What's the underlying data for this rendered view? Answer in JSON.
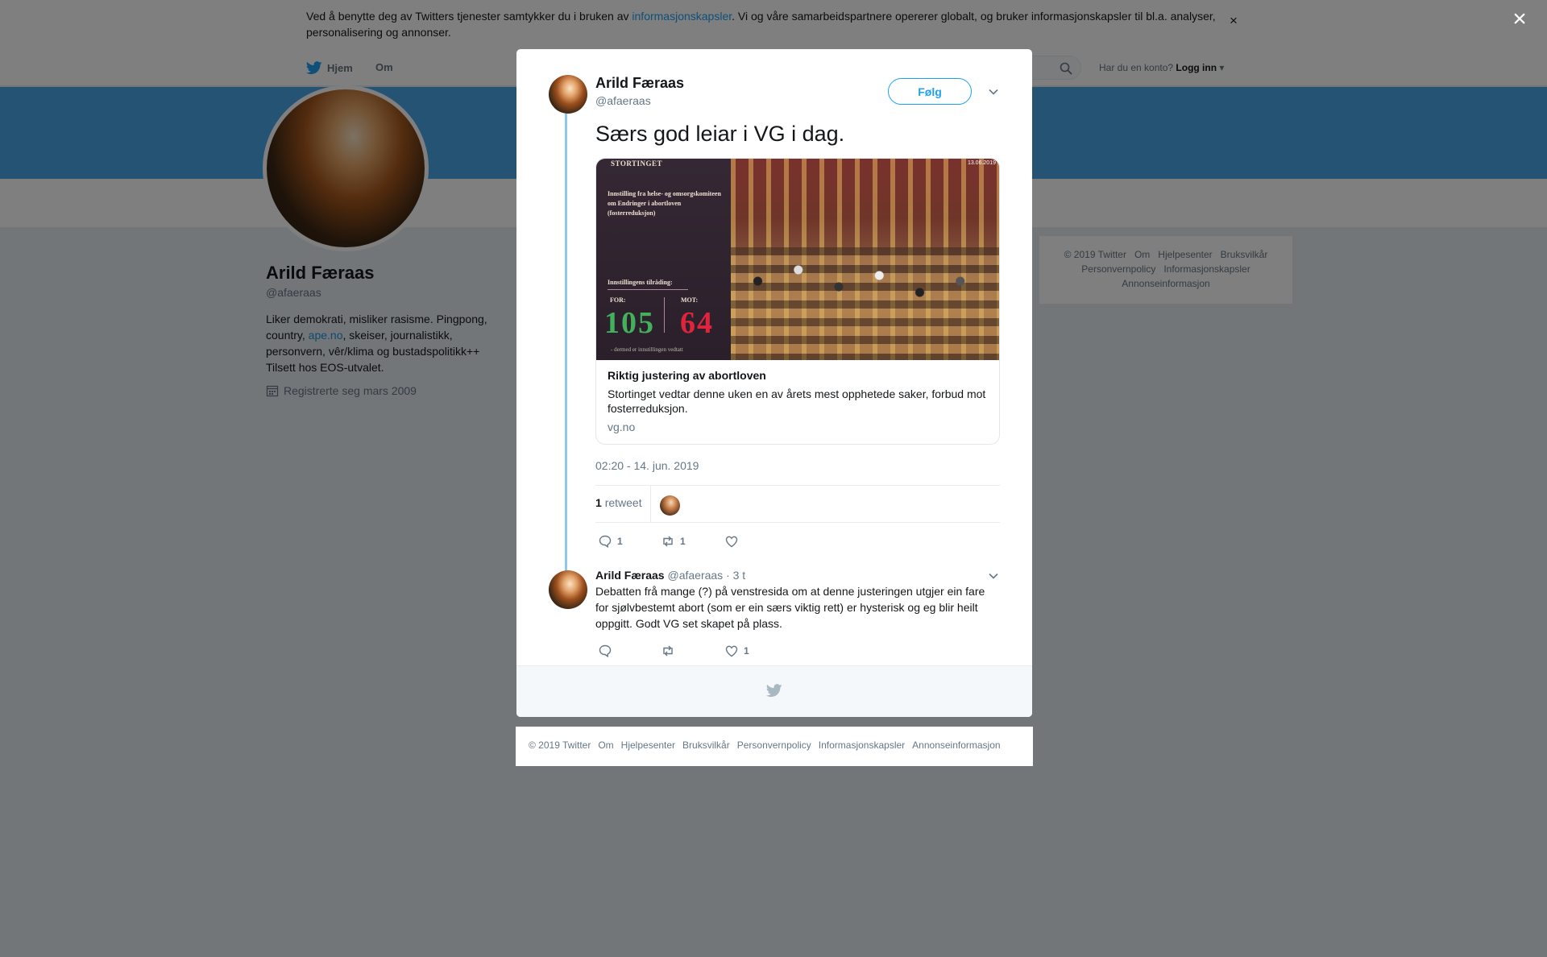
{
  "cookie_banner": {
    "text_before": "Ved å benytte deg av Twitters tjenester samtykker du i bruken av ",
    "link": "informasjonskapsler",
    "text_after": ". Vi og våre samarbeidspartnere opererer globalt, og bruker informasjonskapsler til bl.a. analyser, personalisering og annonser.",
    "close": "×"
  },
  "nav": {
    "home": "Hjem",
    "about": "Om",
    "login_prompt": "Har du en konto?",
    "login": "Logg inn"
  },
  "profile": {
    "name": "Arild Færaas",
    "handle": "@afaeraas",
    "bio_before": "Liker demokrati, misliker rasisme. Pingpong, country, ",
    "bio_link": "ape.no",
    "bio_after": ", skeiser, journalistikk, personvern, vêr/klima og bustadspolitikk++ Tilsett hos EOS-utvalet.",
    "joined": "Registrerte seg mars 2009"
  },
  "side_footer": [
    "© 2019 Twitter",
    "Om",
    "Hjelpesenter",
    "Bruksvilkår",
    "Personvernpolicy",
    "Informasjonskapsler",
    "Annonseinformasjon"
  ],
  "overlay_close": "×",
  "tweet": {
    "name": "Arild Færaas",
    "handle": "@afaeraas",
    "follow": "Følg",
    "text": "Særs god leiar i VG i dag.",
    "card": {
      "image": {
        "brand": "STORTINGET",
        "date": "13.06.2019",
        "heading": "Innstilling fra helse- og omsorgskomiteen om Endringer i abortloven (fosterreduksjon)",
        "recommendation": "Innstillingens tilråding:",
        "for_label": "FOR:",
        "for_value": "105",
        "against_label": "MOT:",
        "against_value": "64",
        "footnote": "- dermed er innstillingen vedtatt"
      },
      "title": "Riktig justering av abortloven",
      "description": "Stortinget vedtar denne uken en av årets mest opphetede saker, forbud mot fosterreduksjon.",
      "domain": "vg.no"
    },
    "timestamp": "02:20 - 14. jun. 2019",
    "retweet_count": "1",
    "retweet_label": "retweet",
    "actions": {
      "replies": "1",
      "retweets": "1",
      "likes": ""
    }
  },
  "reply": {
    "name": "Arild Færaas",
    "handle": "@afaeraas",
    "time": "· 3 t",
    "text": "Debatten frå mange (?) på venstresida om at denne justeringen utgjer ein fare for sjølvbestemt abort (som er ein særs viktig rett) er hysterisk og eg blir heilt oppgitt. Godt VG set skapet på plass.",
    "actions": {
      "replies": "",
      "retweets": "",
      "likes": "1"
    }
  },
  "footer": [
    "© 2019 Twitter",
    "Om",
    "Hjelpesenter",
    "Bruksvilkår",
    "Personvernpolicy",
    "Informasjonskapsler",
    "Annonseinformasjon"
  ],
  "colors": {
    "twitter_blue": "#1da1f2",
    "banner": "#4aa6e9",
    "thread_line": "#8ec8ed",
    "for_green": "#43b05c",
    "against_red": "#e0243c"
  }
}
